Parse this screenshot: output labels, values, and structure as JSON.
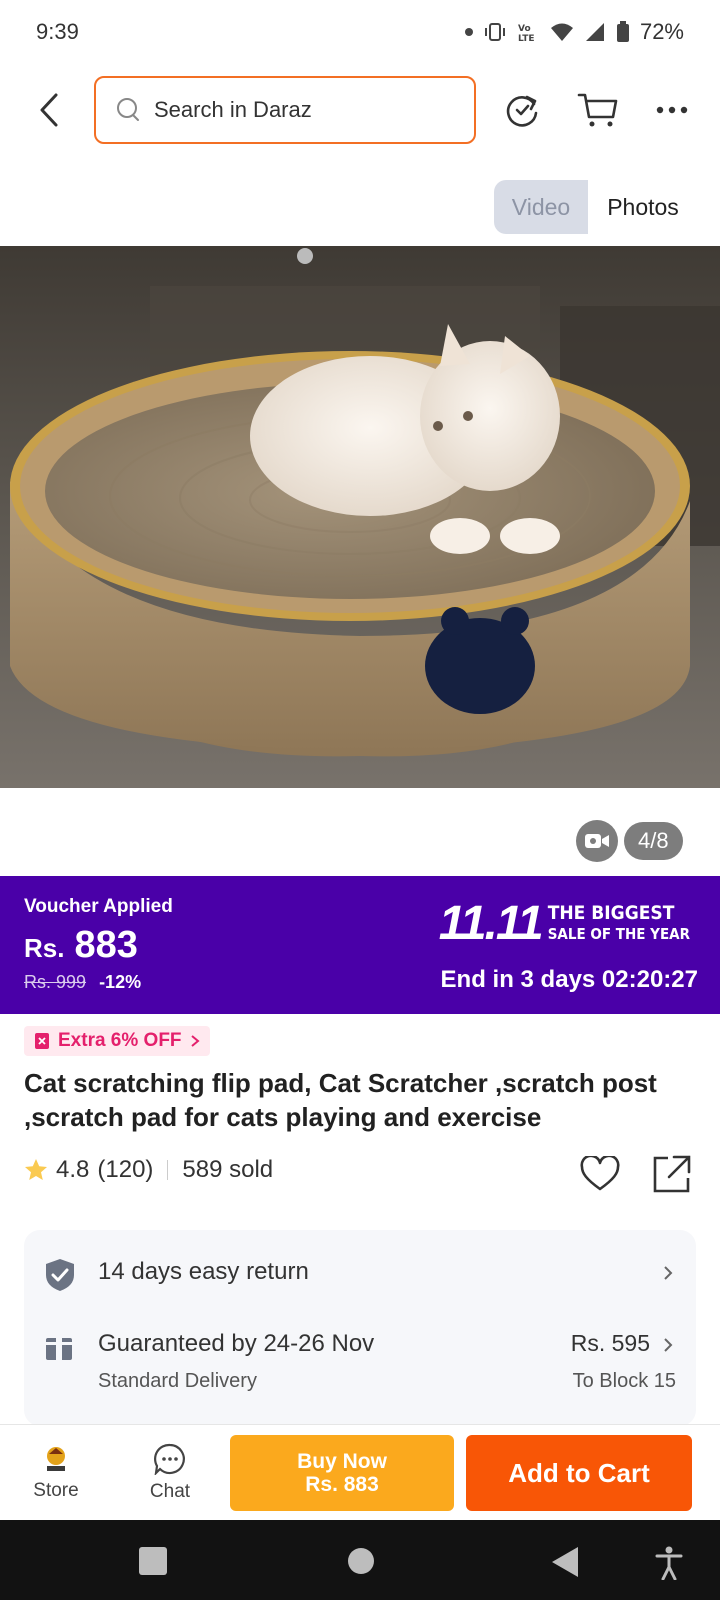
{
  "status": {
    "time": "9:39",
    "battery": "72%"
  },
  "search": {
    "placeholder": "Search in Daraz"
  },
  "media": {
    "video_tab": "Video",
    "photos_tab": "Photos",
    "pagination": "4/8"
  },
  "promo": {
    "voucher_label": "Voucher Applied",
    "currency": "Rs.",
    "price": "883",
    "old_price": "Rs. 999",
    "discount": "-12%",
    "campaign_number": "11.11",
    "campaign_line1": "THE BIGGEST",
    "campaign_line2": "SALE OF THE YEAR",
    "countdown": "End in 3 days 02:20:27",
    "bg_color": "#4a00a8"
  },
  "extra_offer": {
    "label": "Extra 6% OFF"
  },
  "product": {
    "title": "Cat scratching flip pad, Cat Scratcher ,scratch post ,scratch pad for cats playing and exercise",
    "rating": "4.8",
    "reviews": "(120)",
    "sold": "589 sold"
  },
  "services": {
    "return": {
      "label": "14 days easy return"
    },
    "delivery": {
      "label": "Guaranteed by 24-26 Nov",
      "sub": "Standard Delivery",
      "fee": "Rs. 595",
      "location": "To Block 15"
    }
  },
  "actions": {
    "store_label": "Store",
    "chat_label": "Chat",
    "buy_now_line1": "Buy Now",
    "buy_now_line2": "Rs. 883",
    "add_to_cart": "Add to Cart",
    "buy_color": "#fba91d",
    "cart_color": "#f85606"
  }
}
